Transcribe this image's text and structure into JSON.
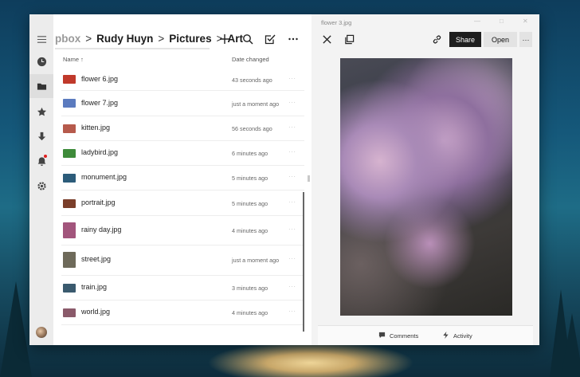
{
  "breadcrumb": {
    "items": [
      "pbox",
      "Rudy Huyn",
      "Pictures",
      "Art"
    ],
    "separator": ">"
  },
  "list": {
    "col_name": "Name",
    "col_date": "Date changed",
    "files": [
      {
        "name": "flower 6.jpg",
        "date": "43 seconds ago",
        "color": "#c0392b"
      },
      {
        "name": "flower 7.jpg",
        "date": "just a moment ago",
        "color": "#5b7bbf"
      },
      {
        "name": "kitten.jpg",
        "date": "56 seconds ago",
        "color": "#b65a4c"
      },
      {
        "name": "ladybird.jpg",
        "date": "6 minutes ago",
        "color": "#3e8b3a"
      },
      {
        "name": "monument.jpg",
        "date": "5 minutes ago",
        "color": "#2c5c7a"
      },
      {
        "name": "portrait.jpg",
        "date": "5 minutes ago",
        "color": "#7a3e2a"
      },
      {
        "name": "rainy day.jpg",
        "date": "4 minutes ago",
        "color": "#a2557c"
      },
      {
        "name": "street.jpg",
        "date": "just a moment ago",
        "color": "#6e6a5a"
      },
      {
        "name": "train.jpg",
        "date": "3 minutes ago",
        "color": "#3a5a6e"
      },
      {
        "name": "world.jpg",
        "date": "4 minutes ago",
        "color": "#8a5a6a"
      }
    ],
    "more_glyph": "···"
  },
  "preview": {
    "title": "flower 3.jpg",
    "share_label": "Share",
    "open_label": "Open",
    "more_glyph": "···",
    "tabs": {
      "comments": "Comments",
      "activity": "Activity"
    }
  },
  "icons": {
    "rail": [
      "menu-icon",
      "clock-icon",
      "folder-icon",
      "star-icon",
      "download-icon",
      "bell-icon",
      "gear-icon"
    ],
    "toolbar": [
      "plus-icon",
      "search-icon",
      "check-square-icon",
      "more-icon"
    ],
    "preview": [
      "close-icon",
      "copy-icon",
      "link-icon"
    ]
  },
  "colors": {
    "accent_dark": "#1e1e1e",
    "notification": "#e02020"
  }
}
